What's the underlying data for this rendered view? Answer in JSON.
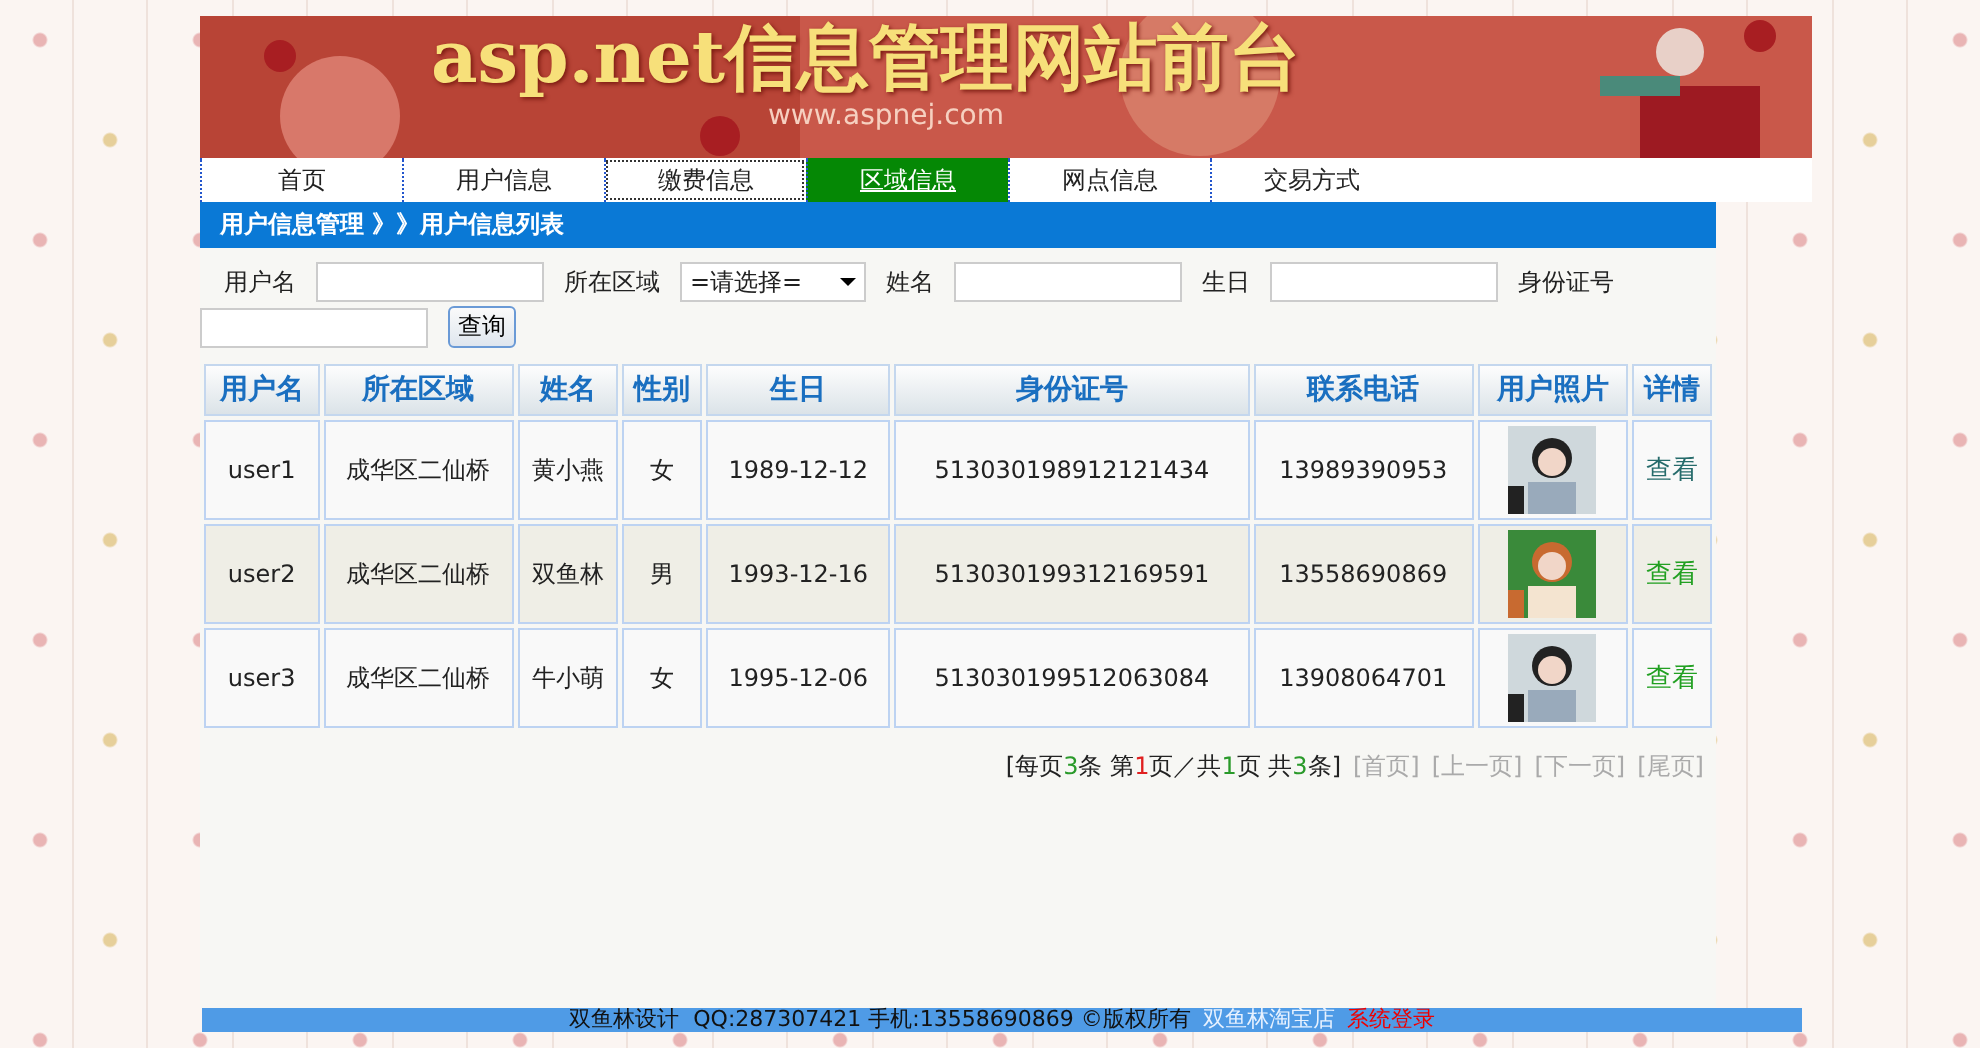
{
  "banner": {
    "title": "asp.net信息管理网站前台",
    "url": "www.aspnej.com"
  },
  "nav": [
    {
      "label": "首页",
      "selected": false,
      "focused": false
    },
    {
      "label": "用户信息",
      "selected": false,
      "focused": false
    },
    {
      "label": "缴费信息",
      "selected": false,
      "focused": true
    },
    {
      "label": "区域信息",
      "selected": true,
      "focused": false
    },
    {
      "label": "网点信息",
      "selected": false,
      "focused": false
    },
    {
      "label": "交易方式",
      "selected": false,
      "focused": false
    }
  ],
  "breadcrumb": "用户信息管理 》》用户信息列表",
  "search": {
    "fields": [
      {
        "label": "用户名",
        "kind": "text"
      },
      {
        "label": "所在区域",
        "kind": "select",
        "value": "=请选择="
      },
      {
        "label": "姓名",
        "kind": "text"
      },
      {
        "label": "生日",
        "kind": "text"
      },
      {
        "label": "身份证号",
        "kind": "text"
      }
    ],
    "button": "查询"
  },
  "table": {
    "columns": [
      "用户名",
      "所在区域",
      "姓名",
      "性别",
      "生日",
      "身份证号",
      "联系电话",
      "用户照片",
      "详情"
    ],
    "rows": [
      {
        "cells": [
          "user1",
          "成华区二仙桥",
          "黄小燕",
          "女",
          "1989-12-12",
          "513030198912121434",
          "13989390953"
        ],
        "link": "查看",
        "visited": true
      },
      {
        "cells": [
          "user2",
          "成华区二仙桥",
          "双鱼林",
          "男",
          "1993-12-16",
          "513030199312169591",
          "13558690869"
        ],
        "link": "查看",
        "visited": false
      },
      {
        "cells": [
          "user3",
          "成华区二仙桥",
          "牛小萌",
          "女",
          "1995-12-06",
          "513030199512063084",
          "13908064701"
        ],
        "link": "查看",
        "visited": false
      }
    ]
  },
  "pagination": {
    "info": [
      {
        "text": "[每页",
        "kind": "text"
      },
      {
        "text": "3",
        "kind": "count"
      },
      {
        "text": "条 第",
        "kind": "text"
      },
      {
        "text": "1",
        "kind": "current"
      },
      {
        "text": "页／共",
        "kind": "text"
      },
      {
        "text": "1",
        "kind": "count"
      },
      {
        "text": "页 共",
        "kind": "text"
      },
      {
        "text": "3",
        "kind": "count"
      },
      {
        "text": "条]",
        "kind": "text"
      }
    ],
    "links": [
      {
        "label": "[首页]",
        "disabled": true
      },
      {
        "label": "[上一页]",
        "disabled": true
      },
      {
        "label": "[下一页]",
        "disabled": true
      },
      {
        "label": "[尾页]",
        "disabled": true
      }
    ]
  },
  "footer": {
    "text": "双鱼林设计  QQ:287307421 手机:13558690869 ©版权所有",
    "links": [
      {
        "label": "双鱼林淘宝店",
        "kind": "shop"
      },
      {
        "label": "系统登录",
        "kind": "login"
      }
    ]
  }
}
